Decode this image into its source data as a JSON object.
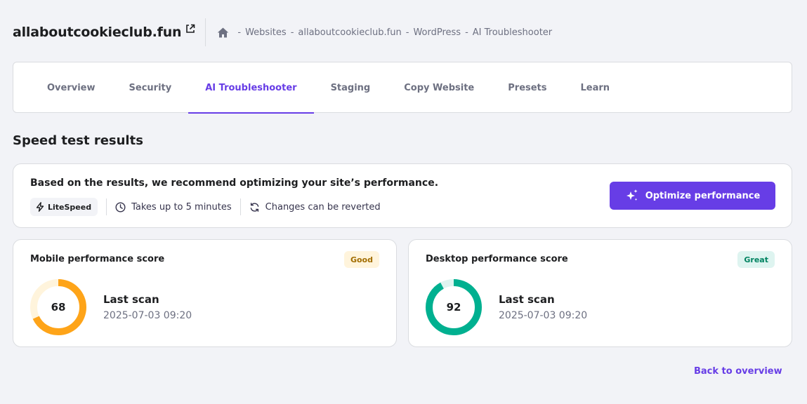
{
  "header": {
    "site_title": "allaboutcookieclub.fun",
    "breadcrumb": [
      "Websites",
      "allaboutcookieclub.fun",
      "WordPress",
      "AI Troubleshooter"
    ],
    "separator": "-"
  },
  "tabs": [
    {
      "label": "Overview",
      "active": false
    },
    {
      "label": "Security",
      "active": false
    },
    {
      "label": "AI Troubleshooter",
      "active": true
    },
    {
      "label": "Staging",
      "active": false
    },
    {
      "label": "Copy Website",
      "active": false
    },
    {
      "label": "Presets",
      "active": false
    },
    {
      "label": "Learn",
      "active": false
    }
  ],
  "section_title": "Speed test results",
  "recommendation": {
    "text": "Based on the results, we recommend optimizing your site’s performance.",
    "pill": "LiteSpeed",
    "duration": "Takes up to 5 minutes",
    "revert": "Changes can be reverted",
    "button": "Optimize performance"
  },
  "mobile": {
    "title": "Mobile performance score",
    "badge": "Good",
    "score": "68",
    "score_fraction": 0.68,
    "color": "#fea419",
    "track_color": "#fff4dc",
    "scan_label": "Last scan",
    "scan_date": "2025-07-03 09:20"
  },
  "desktop": {
    "title": "Desktop performance score",
    "badge": "Great",
    "score": "92",
    "score_fraction": 0.92,
    "color": "#00b090",
    "track_color": "#def4f0",
    "scan_label": "Last scan",
    "scan_date": "2025-07-03 09:20"
  },
  "back_link": "Back to overview",
  "colors": {
    "accent": "#673de6",
    "background": "#f2f3f7"
  }
}
